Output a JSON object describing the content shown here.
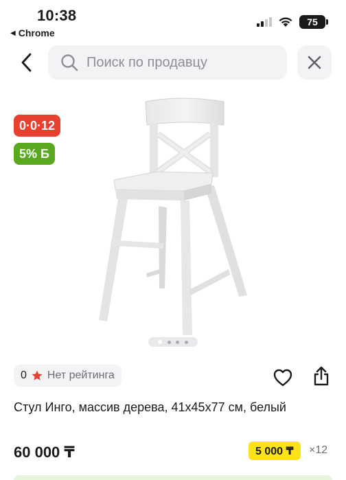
{
  "status_bar": {
    "time": "10:38",
    "back_app": "Chrome",
    "battery": "75",
    "icons": [
      "cellular-signal-icon",
      "wifi-icon",
      "battery-icon"
    ]
  },
  "nav": {
    "search_placeholder": "Поиск по продавцу",
    "icons": [
      "chevron-left-icon",
      "search-icon",
      "close-icon"
    ]
  },
  "product": {
    "badges": {
      "installment": "0·0·12",
      "bonus": "5% Б"
    },
    "gallery": {
      "image_count": 4,
      "active_index": 0
    },
    "rating": {
      "count": "0",
      "label": "Нет рейтинга"
    },
    "title": "Стул Инго, массив дерева, 41x45x77 см, белый",
    "price": "60 000 ₸",
    "installment_price": "5 000 ₸",
    "installment_multiplier": "×12"
  },
  "colors": {
    "installment_badge": "#e8402f",
    "bonus_badge": "#5aa81e",
    "installment_price_bg": "#ffe31a",
    "star": "#e8402f",
    "search_bg": "#f2f3f5"
  }
}
